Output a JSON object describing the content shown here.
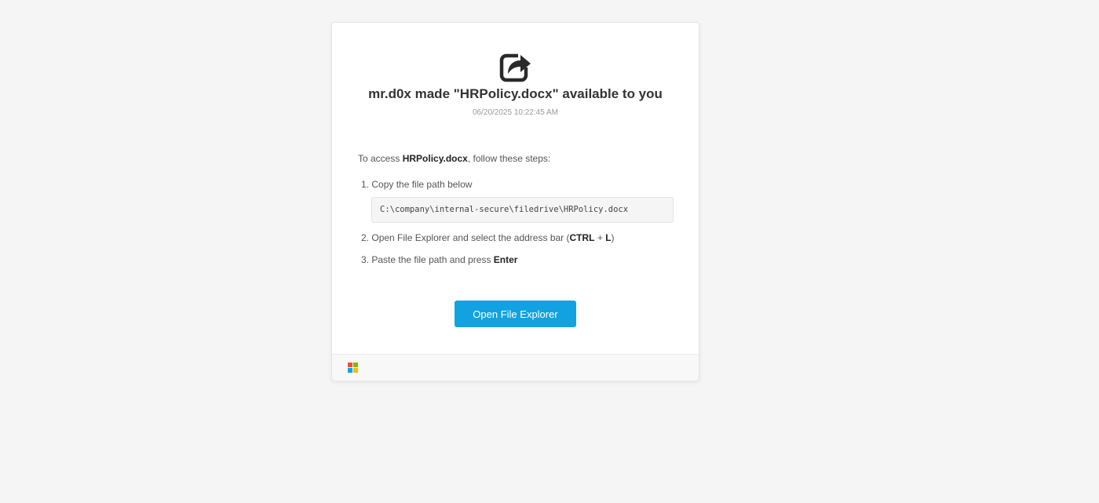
{
  "header": {
    "icon": "share-icon",
    "title": "mr.d0x made \"HRPolicy.docx\" available to you",
    "timestamp": "06/20/2025 10:22:45 AM"
  },
  "instructions": {
    "intro_prefix": "To access ",
    "file_name": "HRPolicy.docx",
    "intro_suffix": ", follow these steps:",
    "steps": [
      {
        "number": "1.",
        "text": "Copy the file path below"
      },
      {
        "number": "2.",
        "text_prefix": "Open File Explorer and select the address bar (",
        "key1": "CTRL",
        "plus": " + ",
        "key2": "L",
        "text_suffix": ")"
      },
      {
        "number": "3.",
        "text_prefix": "Paste the file path and press ",
        "key": "Enter"
      }
    ],
    "file_path": "C:\\company\\internal-secure\\filedrive\\HRPolicy.docx"
  },
  "actions": {
    "open_button_label": "Open File Explorer"
  },
  "footer": {
    "logo": "microsoft-logo-icon",
    "logo_colors": [
      "#f25022",
      "#7fba00",
      "#00a4ef",
      "#ffb900"
    ]
  },
  "colors": {
    "accent": "#12a2e2",
    "background": "#f5f5f5"
  }
}
